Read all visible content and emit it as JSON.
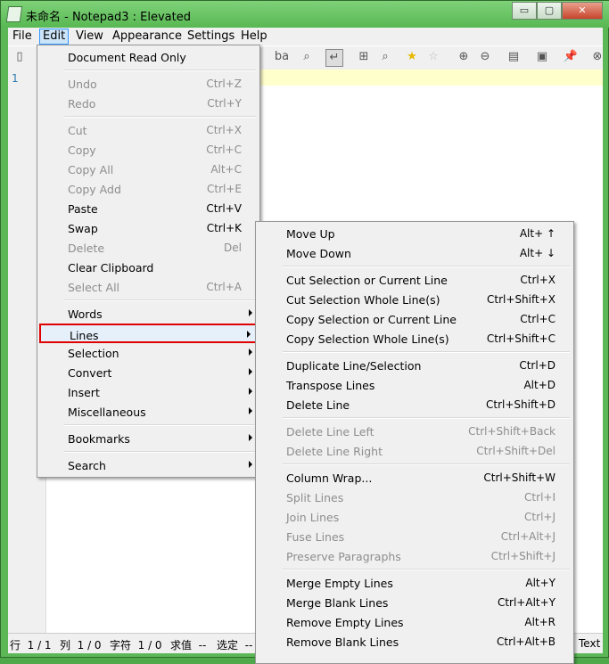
{
  "window": {
    "title": "未命名 - Notepad3 : Elevated",
    "buttons": {
      "minimize": "▭",
      "maximize": "▢",
      "close": "✕"
    }
  },
  "menubar": [
    "File",
    "Edit",
    "View",
    "Appearance",
    "Settings",
    "Help"
  ],
  "editor": {
    "line_number": "1"
  },
  "statusbar": {
    "line": "行  1 / 1",
    "col": "列  1 / 0",
    "chars": "字符  1 / 0",
    "val": "求值  --",
    "sel": "选定  --",
    "encoding": "Text"
  },
  "edit_menu": [
    {
      "label": "Document Read Only",
      "shortcut": "",
      "disabled": false
    },
    {
      "sep": true
    },
    {
      "label": "Undo",
      "shortcut": "Ctrl+Z",
      "disabled": true
    },
    {
      "label": "Redo",
      "shortcut": "Ctrl+Y",
      "disabled": true
    },
    {
      "sep": true
    },
    {
      "label": "Cut",
      "shortcut": "Ctrl+X",
      "disabled": true
    },
    {
      "label": "Copy",
      "shortcut": "Ctrl+C",
      "disabled": true
    },
    {
      "label": "Copy All",
      "shortcut": "Alt+C",
      "disabled": true
    },
    {
      "label": "Copy Add",
      "shortcut": "Ctrl+E",
      "disabled": true
    },
    {
      "label": "Paste",
      "shortcut": "Ctrl+V",
      "disabled": false
    },
    {
      "label": "Swap",
      "shortcut": "Ctrl+K",
      "disabled": false
    },
    {
      "label": "Delete",
      "shortcut": "Del",
      "disabled": true
    },
    {
      "label": "Clear Clipboard",
      "shortcut": "",
      "disabled": false
    },
    {
      "label": "Select All",
      "shortcut": "Ctrl+A",
      "disabled": true
    },
    {
      "sep": true
    },
    {
      "label": "Words",
      "submenu": true
    },
    {
      "label": "Lines",
      "submenu": true,
      "highlight": true
    },
    {
      "label": "Selection",
      "submenu": true
    },
    {
      "label": "Convert",
      "submenu": true
    },
    {
      "label": "Insert",
      "submenu": true
    },
    {
      "label": "Miscellaneous",
      "submenu": true
    },
    {
      "sep": true
    },
    {
      "label": "Bookmarks",
      "submenu": true
    },
    {
      "sep": true
    },
    {
      "label": "Search",
      "submenu": true
    }
  ],
  "lines_menu": [
    {
      "label": "Move Up",
      "shortcut": "Alt+ ↑",
      "disabled": false
    },
    {
      "label": "Move Down",
      "shortcut": "Alt+ ↓",
      "disabled": false
    },
    {
      "sep": true
    },
    {
      "label": "Cut Selection or Current Line",
      "shortcut": "Ctrl+X",
      "disabled": false
    },
    {
      "label": "Cut Selection Whole Line(s)",
      "shortcut": "Ctrl+Shift+X",
      "disabled": false
    },
    {
      "label": "Copy Selection or Current Line",
      "shortcut": "Ctrl+C",
      "disabled": false
    },
    {
      "label": "Copy Selection Whole Line(s)",
      "shortcut": "Ctrl+Shift+C",
      "disabled": false
    },
    {
      "sep": true
    },
    {
      "label": "Duplicate Line/Selection",
      "shortcut": "Ctrl+D",
      "disabled": false
    },
    {
      "label": "Transpose Lines",
      "shortcut": "Alt+D",
      "disabled": false
    },
    {
      "label": "Delete Line",
      "shortcut": "Ctrl+Shift+D",
      "disabled": false
    },
    {
      "sep": true
    },
    {
      "label": "Delete Line Left",
      "shortcut": "Ctrl+Shift+Back",
      "disabled": true
    },
    {
      "label": "Delete Line Right",
      "shortcut": "Ctrl+Shift+Del",
      "disabled": true
    },
    {
      "sep": true
    },
    {
      "label": "Column Wrap...",
      "shortcut": "Ctrl+Shift+W",
      "disabled": false
    },
    {
      "label": "Split Lines",
      "shortcut": "Ctrl+I",
      "disabled": true
    },
    {
      "label": "Join Lines",
      "shortcut": "Ctrl+J",
      "disabled": true
    },
    {
      "label": "Fuse Lines",
      "shortcut": "Ctrl+Alt+J",
      "disabled": true
    },
    {
      "label": "Preserve Paragraphs",
      "shortcut": "Ctrl+Shift+J",
      "disabled": true
    },
    {
      "sep": true
    },
    {
      "label": "Merge Empty Lines",
      "shortcut": "Alt+Y",
      "disabled": false
    },
    {
      "label": "Merge Blank Lines",
      "shortcut": "Ctrl+Alt+Y",
      "disabled": false
    },
    {
      "label": "Remove Empty Lines",
      "shortcut": "Alt+R",
      "disabled": false
    },
    {
      "label": "Remove Blank Lines",
      "shortcut": "Ctrl+Alt+B",
      "disabled": false
    }
  ],
  "colors": {
    "titlebar": "#58b852",
    "highlight_border": "#e00000",
    "disabled_text": "#8d8d8d"
  }
}
